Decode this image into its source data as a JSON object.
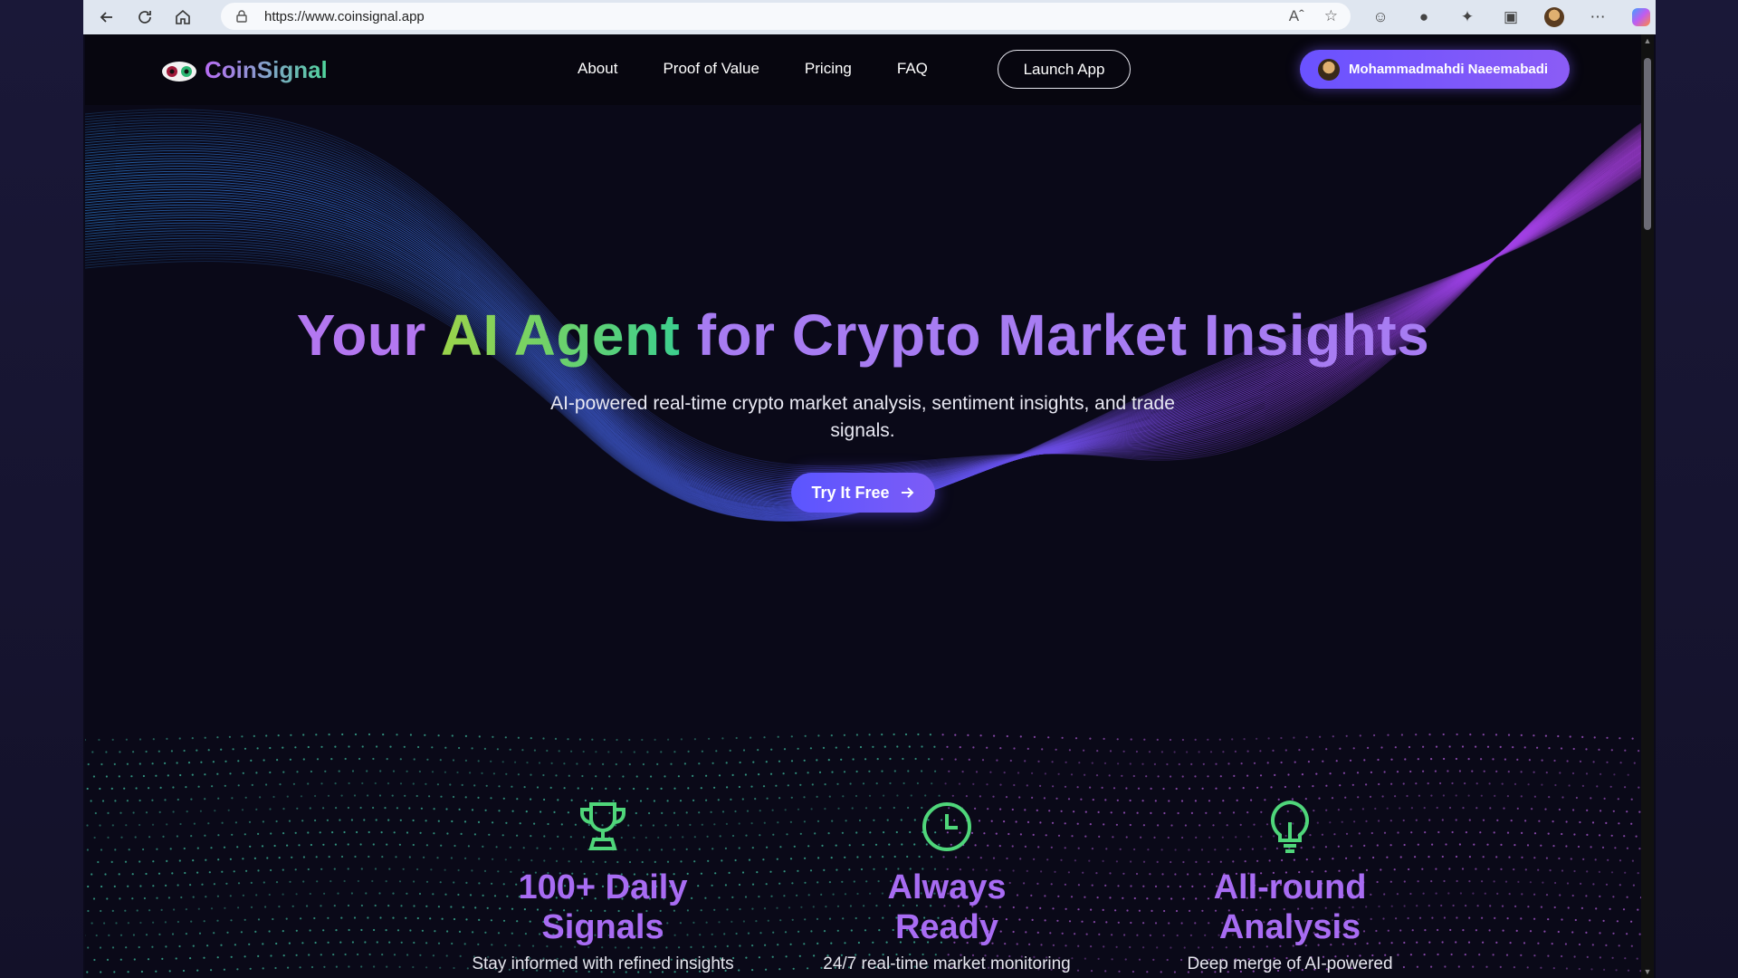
{
  "browser": {
    "url": "https://www.coinsignal.app"
  },
  "site": {
    "brand": "CoinSignal",
    "nav": [
      "About",
      "Proof of Value",
      "Pricing",
      "FAQ"
    ],
    "launch_label": "Launch App",
    "user_name": "Mohammadmahdi Naeemabadi"
  },
  "hero": {
    "title_part1": "Your ",
    "title_part2": "AI Agent",
    "title_part3": " for Crypto Market Insights",
    "subtitle": "AI-powered real-time crypto market analysis, sentiment insights, and trade signals.",
    "cta_label": "Try It Free"
  },
  "features": [
    {
      "icon": "trophy-icon",
      "title_line1": "100+ Daily",
      "title_line2": "Signals",
      "desc": "Stay informed with refined insights"
    },
    {
      "icon": "clock-icon",
      "title_line1": "Always",
      "title_line2": "Ready",
      "desc": "24/7 real-time market monitoring"
    },
    {
      "icon": "lightbulb-icon",
      "title_line1": "All-round",
      "title_line2": "Analysis",
      "desc": "Deep merge of AI-powered"
    }
  ],
  "colors": {
    "accent_purple": "#a86cf3",
    "accent_green": "#3ccf8e",
    "button_blue": "#5b55ff",
    "page_bg": "#0a0918"
  }
}
